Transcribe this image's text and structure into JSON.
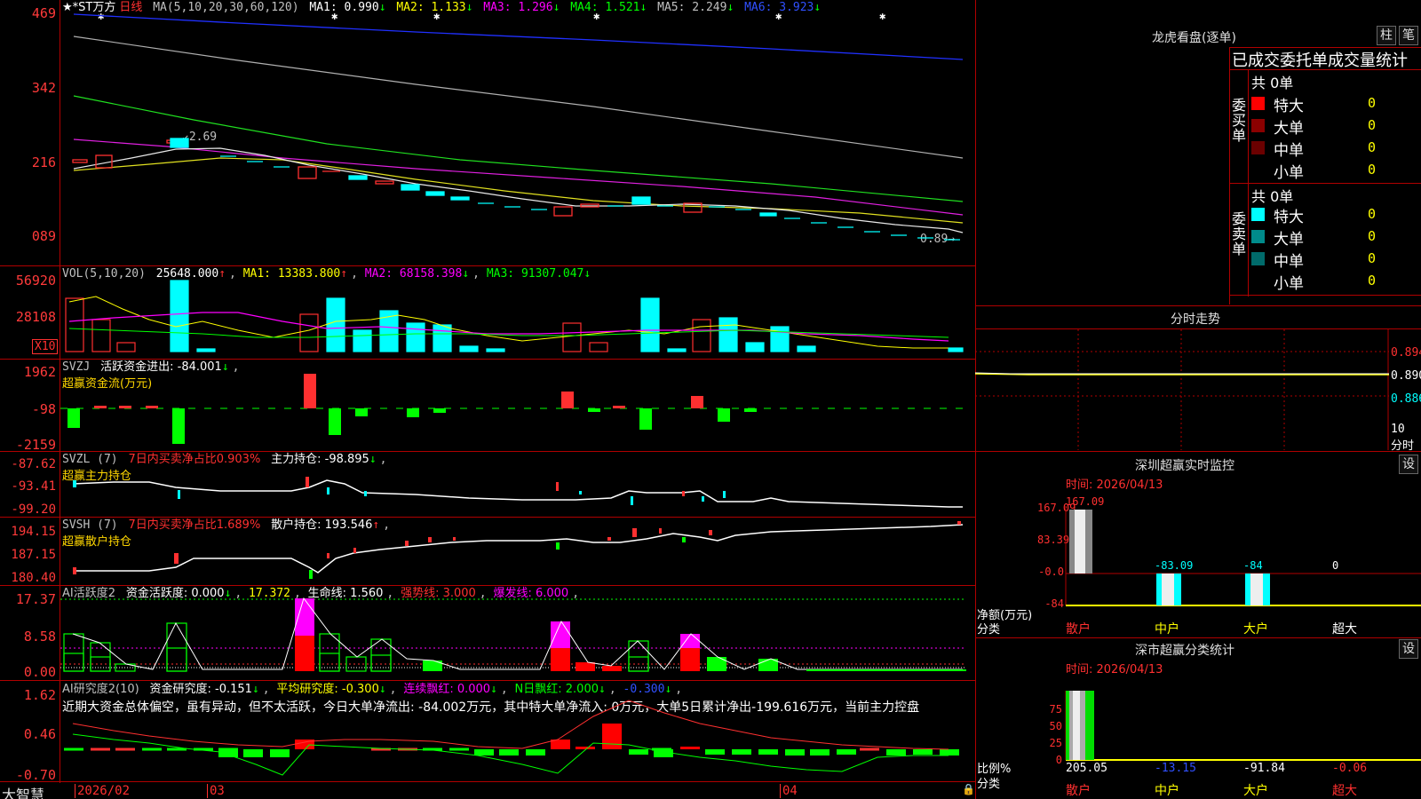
{
  "colors": {
    "up": "#ff3030",
    "down": "#00ffff",
    "ma1": "#ffffff",
    "ma2": "#ffff00",
    "ma3": "#ff00ff",
    "ma4": "#00ff00",
    "ma5": "#c0c0c0",
    "ma6": "#0000ff",
    "grid": "#b00000"
  },
  "main": {
    "stock": "★*ST万方",
    "period": "日线",
    "ma_label": "MA(5,10,20,30,60,120)",
    "ma1": "MA1: 0.990",
    "ma2": "MA2: 1.133",
    "ma3": "MA3: 1.296",
    "ma4": "MA4: 1.521",
    "ma5": "MA5: 2.249",
    "ma6": "MA6: 3.923",
    "axis": [
      "469",
      "342",
      "216",
      "089"
    ],
    "high_note": "2.69",
    "low_note": "0.89"
  },
  "vol": {
    "label": "VOL(5,10,20)",
    "v": "25648.000",
    "ma1": "MA1: 13383.800",
    "ma2": "MA2: 68158.398",
    "ma3": "MA3: 91307.047",
    "axis": [
      "56920",
      "28108"
    ],
    "x10": "X10"
  },
  "svzj": {
    "label": "SVZJ",
    "desc": "活跃资金进出: -84.001",
    "sub": "超赢资金流(万元)",
    "axis": [
      "1962",
      "-98",
      "-2159"
    ]
  },
  "svzl": {
    "label": "SVZL (7)",
    "desc1": "7日内买卖净占比0.903%",
    "desc2": "主力持仓: -98.895",
    "sub": "超赢主力持仓",
    "axis": [
      "-87.62",
      "-93.41",
      "-99.20"
    ]
  },
  "svsh": {
    "label": "SVSH (7)",
    "desc1": "7日内买卖净占比1.689%",
    "desc2": "散户持仓: 193.546",
    "sub": "超赢散户持仓",
    "axis": [
      "194.15",
      "187.15",
      "180.40"
    ]
  },
  "ai1": {
    "label": "AI活跃度2",
    "desc1": "资金活跃度: 0.000",
    "desc2": "17.372",
    "desc3": "生命线: 1.560",
    "desc4": "强势线: 3.000",
    "desc5": "爆发线: 6.000",
    "axis": [
      "17.37",
      "8.58",
      "0.00"
    ]
  },
  "ai2": {
    "label": "AI研究度2(10)",
    "desc1": "资金研究度: -0.151",
    "desc2": "平均研究度: -0.300",
    "desc3": "连续飘红: 0.000",
    "desc4": "N日飘红: 2.000",
    "desc5": "-0.300",
    "note": "近期大资金总体偏空，虽有异动，但不太活跃，今日大单净流出: -84.002万元，其中特大单净流入: 0万元，大单5日累计净出-199.616万元，当前主力控盘",
    "axis": [
      "1.62",
      "0.46",
      "-0.70"
    ]
  },
  "xaxis": {
    "brand": "大智慧",
    "d1": "2026/02",
    "d2": "03",
    "d3": "04"
  },
  "right": {
    "title": "龙虎看盘(逐单)",
    "btn1": "柱",
    "btn2": "笔",
    "header": "已成交委托单成交量统计",
    "buy": {
      "title": "委买单",
      "total": "共 0单",
      "rows": [
        {
          "k": "特大",
          "v": "0",
          "c": "#ff0000"
        },
        {
          "k": "大单",
          "v": "0",
          "c": "#8b0000"
        },
        {
          "k": "中单",
          "v": "0",
          "c": "#6b0000"
        },
        {
          "k": "小单",
          "v": "0",
          "c": "#000000"
        }
      ]
    },
    "sell": {
      "title": "委卖单",
      "total": "共 0单",
      "rows": [
        {
          "k": "特大",
          "v": "0",
          "c": "#00ffff"
        },
        {
          "k": "大单",
          "v": "0",
          "c": "#008b8b"
        },
        {
          "k": "中单",
          "v": "0",
          "c": "#006b6b"
        },
        {
          "k": "小单",
          "v": "0",
          "c": "#000000"
        }
      ]
    },
    "fs_title": "分时走势",
    "fs_axis": [
      "0.894",
      "0.890",
      "0.886"
    ],
    "fs_foot1": "10",
    "fs_foot2": "分时",
    "sz_title": "深圳超赢实时监控",
    "sz_btn": "设",
    "sz_time": "时间: 2026/04/13",
    "sz_axis": [
      "167.09",
      "83.39",
      "-0.0",
      "-84"
    ],
    "sz_vals": [
      "167.09",
      "-83.09",
      "-84",
      "0"
    ],
    "sz_ylabel": "净额(万元)",
    "sz_xlabel": "分类",
    "cats": [
      "散户",
      "中户",
      "大户",
      "超大"
    ],
    "ss_title": "深市超赢分类统计",
    "ss_btn": "设",
    "ss_time": "时间: 2026/04/13",
    "ss_axis": [
      "75",
      "50",
      "25",
      "0"
    ],
    "ss_vals": [
      "205.05",
      "-13.15",
      "-91.84",
      "-0.06"
    ],
    "ss_ylabel": "比例%",
    "ss_xlabel": "分类"
  }
}
